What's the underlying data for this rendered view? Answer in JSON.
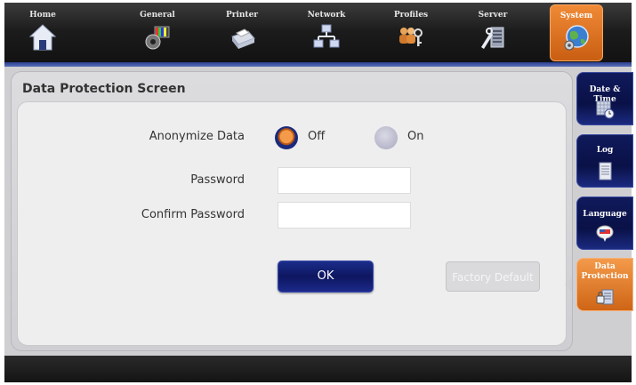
{
  "nav": {
    "items": [
      {
        "label": "Home",
        "icon": "home-icon"
      },
      {
        "label": "General",
        "icon": "general-icon"
      },
      {
        "label": "Printer",
        "icon": "printer-icon"
      },
      {
        "label": "Network",
        "icon": "network-icon"
      },
      {
        "label": "Profiles",
        "icon": "profiles-icon"
      },
      {
        "label": "Server",
        "icon": "server-icon"
      },
      {
        "label": "System",
        "icon": "system-globe-icon",
        "active": true
      }
    ]
  },
  "page": {
    "title": "Data Protection Screen",
    "anonymize": {
      "label": "Anonymize Data",
      "options": [
        "Off",
        "On"
      ],
      "selected": "Off"
    },
    "password": {
      "label": "Password",
      "value": ""
    },
    "confirm_password": {
      "label": "Confirm Password",
      "value": ""
    },
    "ok_label": "OK",
    "factory_default_label": "Factory Default"
  },
  "side_tabs": [
    {
      "label": "Date & Time",
      "icon": "calendar-clock-icon"
    },
    {
      "label": "Log",
      "icon": "log-document-icon"
    },
    {
      "label": "Language",
      "icon": "language-flag-icon"
    },
    {
      "label": "Data Protection",
      "icon": "data-protection-icon",
      "active": true
    }
  ],
  "colors": {
    "accent_orange": "#e47a2c",
    "nav_dark_blue": "#0d1660"
  }
}
